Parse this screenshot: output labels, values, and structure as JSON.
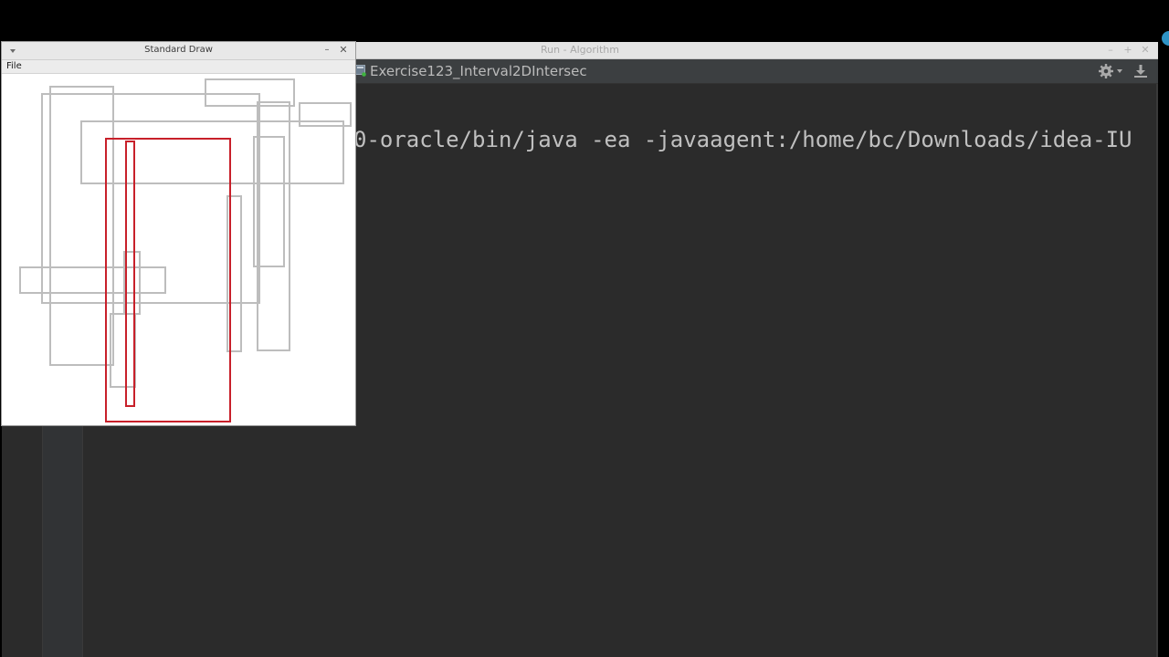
{
  "ide": {
    "window_title": "Run - Algorithm",
    "buttons": {
      "minimize": "–",
      "maximize": "+",
      "close": "✕"
    },
    "run_config": {
      "icon": "application-icon",
      "label": "Exercise123_Interval2DIntersec"
    },
    "toolbar": {
      "gear_icon": "gear-icon",
      "download_icon": "download-icon"
    },
    "console": {
      "command_line": "0-oracle/bin/java -ea -javaagent:/home/bc/Downloads/idea-IU"
    }
  },
  "standard_draw": {
    "window_title": "Standard Draw",
    "buttons": {
      "minimize": "–",
      "close": "✕"
    },
    "menu": {
      "file": "File"
    },
    "canvas": {
      "gray_color": "#bdbdbd",
      "highlight_color": "#c8202a"
    }
  },
  "colors": {
    "ide_background": "#2b2b2b",
    "console_text": "#c0c0c0",
    "accent_circle": "#2f93c6"
  }
}
